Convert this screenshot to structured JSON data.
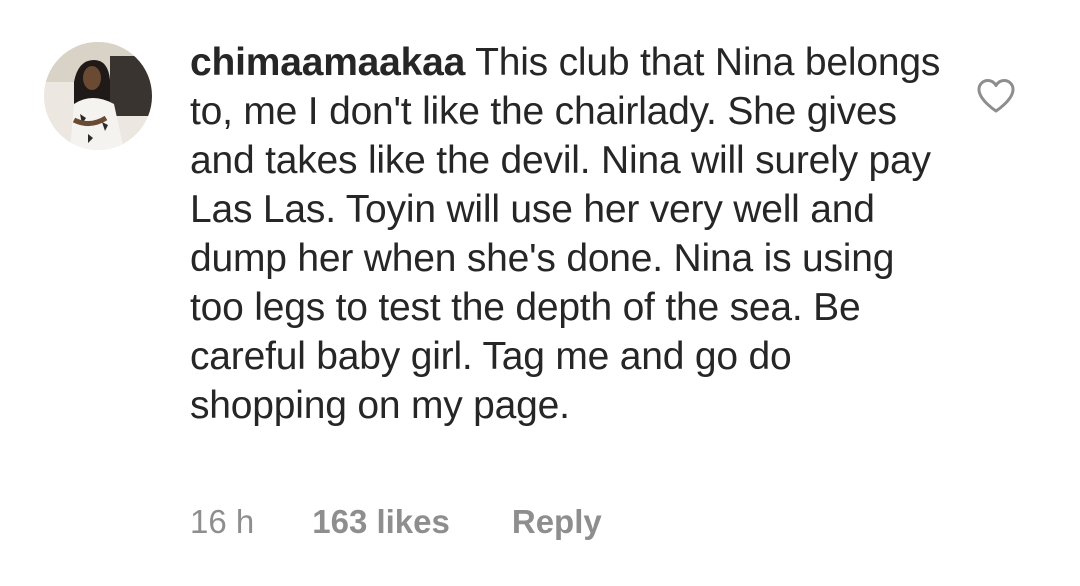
{
  "comment": {
    "username": "chimaamaakaa",
    "text": "This club that Nina belongs to, me I don't like the chairlady. She gives and takes like the devil. Nina will surely pay Las Las. Toyin will use her very well and dump her when she's done. Nina is using too legs to test the depth of the sea. Be careful baby girl. Tag me and go do shopping on my page.",
    "time": "16 h",
    "likes": "163 likes",
    "reply_label": "Reply",
    "like_icon": "heart-outline-icon",
    "avatar_icon": "user-avatar-photo"
  },
  "colors": {
    "text": "#262626",
    "meta": "#8e8e8e",
    "icon": "#8e8e8e",
    "background": "#ffffff"
  }
}
